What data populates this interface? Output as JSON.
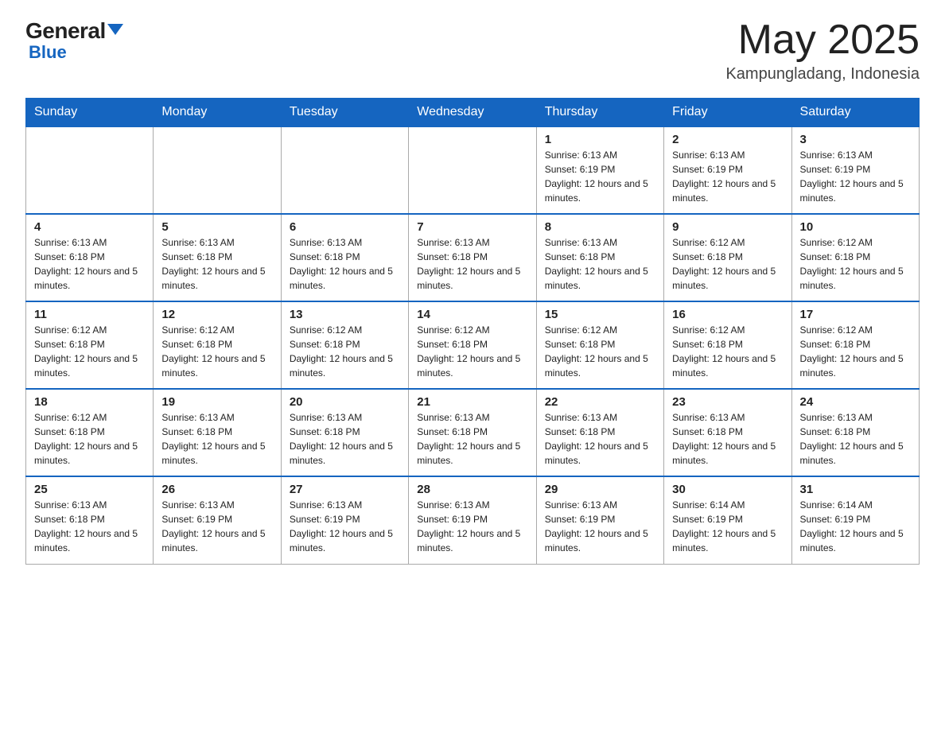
{
  "header": {
    "logo_general": "General",
    "logo_blue": "Blue",
    "month_title": "May 2025",
    "location": "Kampungladang, Indonesia"
  },
  "days_of_week": [
    "Sunday",
    "Monday",
    "Tuesday",
    "Wednesday",
    "Thursday",
    "Friday",
    "Saturday"
  ],
  "weeks": [
    [
      {
        "day": "",
        "info": ""
      },
      {
        "day": "",
        "info": ""
      },
      {
        "day": "",
        "info": ""
      },
      {
        "day": "",
        "info": ""
      },
      {
        "day": "1",
        "info": "Sunrise: 6:13 AM\nSunset: 6:19 PM\nDaylight: 12 hours and 5 minutes."
      },
      {
        "day": "2",
        "info": "Sunrise: 6:13 AM\nSunset: 6:19 PM\nDaylight: 12 hours and 5 minutes."
      },
      {
        "day": "3",
        "info": "Sunrise: 6:13 AM\nSunset: 6:19 PM\nDaylight: 12 hours and 5 minutes."
      }
    ],
    [
      {
        "day": "4",
        "info": "Sunrise: 6:13 AM\nSunset: 6:18 PM\nDaylight: 12 hours and 5 minutes."
      },
      {
        "day": "5",
        "info": "Sunrise: 6:13 AM\nSunset: 6:18 PM\nDaylight: 12 hours and 5 minutes."
      },
      {
        "day": "6",
        "info": "Sunrise: 6:13 AM\nSunset: 6:18 PM\nDaylight: 12 hours and 5 minutes."
      },
      {
        "day": "7",
        "info": "Sunrise: 6:13 AM\nSunset: 6:18 PM\nDaylight: 12 hours and 5 minutes."
      },
      {
        "day": "8",
        "info": "Sunrise: 6:13 AM\nSunset: 6:18 PM\nDaylight: 12 hours and 5 minutes."
      },
      {
        "day": "9",
        "info": "Sunrise: 6:12 AM\nSunset: 6:18 PM\nDaylight: 12 hours and 5 minutes."
      },
      {
        "day": "10",
        "info": "Sunrise: 6:12 AM\nSunset: 6:18 PM\nDaylight: 12 hours and 5 minutes."
      }
    ],
    [
      {
        "day": "11",
        "info": "Sunrise: 6:12 AM\nSunset: 6:18 PM\nDaylight: 12 hours and 5 minutes."
      },
      {
        "day": "12",
        "info": "Sunrise: 6:12 AM\nSunset: 6:18 PM\nDaylight: 12 hours and 5 minutes."
      },
      {
        "day": "13",
        "info": "Sunrise: 6:12 AM\nSunset: 6:18 PM\nDaylight: 12 hours and 5 minutes."
      },
      {
        "day": "14",
        "info": "Sunrise: 6:12 AM\nSunset: 6:18 PM\nDaylight: 12 hours and 5 minutes."
      },
      {
        "day": "15",
        "info": "Sunrise: 6:12 AM\nSunset: 6:18 PM\nDaylight: 12 hours and 5 minutes."
      },
      {
        "day": "16",
        "info": "Sunrise: 6:12 AM\nSunset: 6:18 PM\nDaylight: 12 hours and 5 minutes."
      },
      {
        "day": "17",
        "info": "Sunrise: 6:12 AM\nSunset: 6:18 PM\nDaylight: 12 hours and 5 minutes."
      }
    ],
    [
      {
        "day": "18",
        "info": "Sunrise: 6:12 AM\nSunset: 6:18 PM\nDaylight: 12 hours and 5 minutes."
      },
      {
        "day": "19",
        "info": "Sunrise: 6:13 AM\nSunset: 6:18 PM\nDaylight: 12 hours and 5 minutes."
      },
      {
        "day": "20",
        "info": "Sunrise: 6:13 AM\nSunset: 6:18 PM\nDaylight: 12 hours and 5 minutes."
      },
      {
        "day": "21",
        "info": "Sunrise: 6:13 AM\nSunset: 6:18 PM\nDaylight: 12 hours and 5 minutes."
      },
      {
        "day": "22",
        "info": "Sunrise: 6:13 AM\nSunset: 6:18 PM\nDaylight: 12 hours and 5 minutes."
      },
      {
        "day": "23",
        "info": "Sunrise: 6:13 AM\nSunset: 6:18 PM\nDaylight: 12 hours and 5 minutes."
      },
      {
        "day": "24",
        "info": "Sunrise: 6:13 AM\nSunset: 6:18 PM\nDaylight: 12 hours and 5 minutes."
      }
    ],
    [
      {
        "day": "25",
        "info": "Sunrise: 6:13 AM\nSunset: 6:18 PM\nDaylight: 12 hours and 5 minutes."
      },
      {
        "day": "26",
        "info": "Sunrise: 6:13 AM\nSunset: 6:19 PM\nDaylight: 12 hours and 5 minutes."
      },
      {
        "day": "27",
        "info": "Sunrise: 6:13 AM\nSunset: 6:19 PM\nDaylight: 12 hours and 5 minutes."
      },
      {
        "day": "28",
        "info": "Sunrise: 6:13 AM\nSunset: 6:19 PM\nDaylight: 12 hours and 5 minutes."
      },
      {
        "day": "29",
        "info": "Sunrise: 6:13 AM\nSunset: 6:19 PM\nDaylight: 12 hours and 5 minutes."
      },
      {
        "day": "30",
        "info": "Sunrise: 6:14 AM\nSunset: 6:19 PM\nDaylight: 12 hours and 5 minutes."
      },
      {
        "day": "31",
        "info": "Sunrise: 6:14 AM\nSunset: 6:19 PM\nDaylight: 12 hours and 5 minutes."
      }
    ]
  ]
}
